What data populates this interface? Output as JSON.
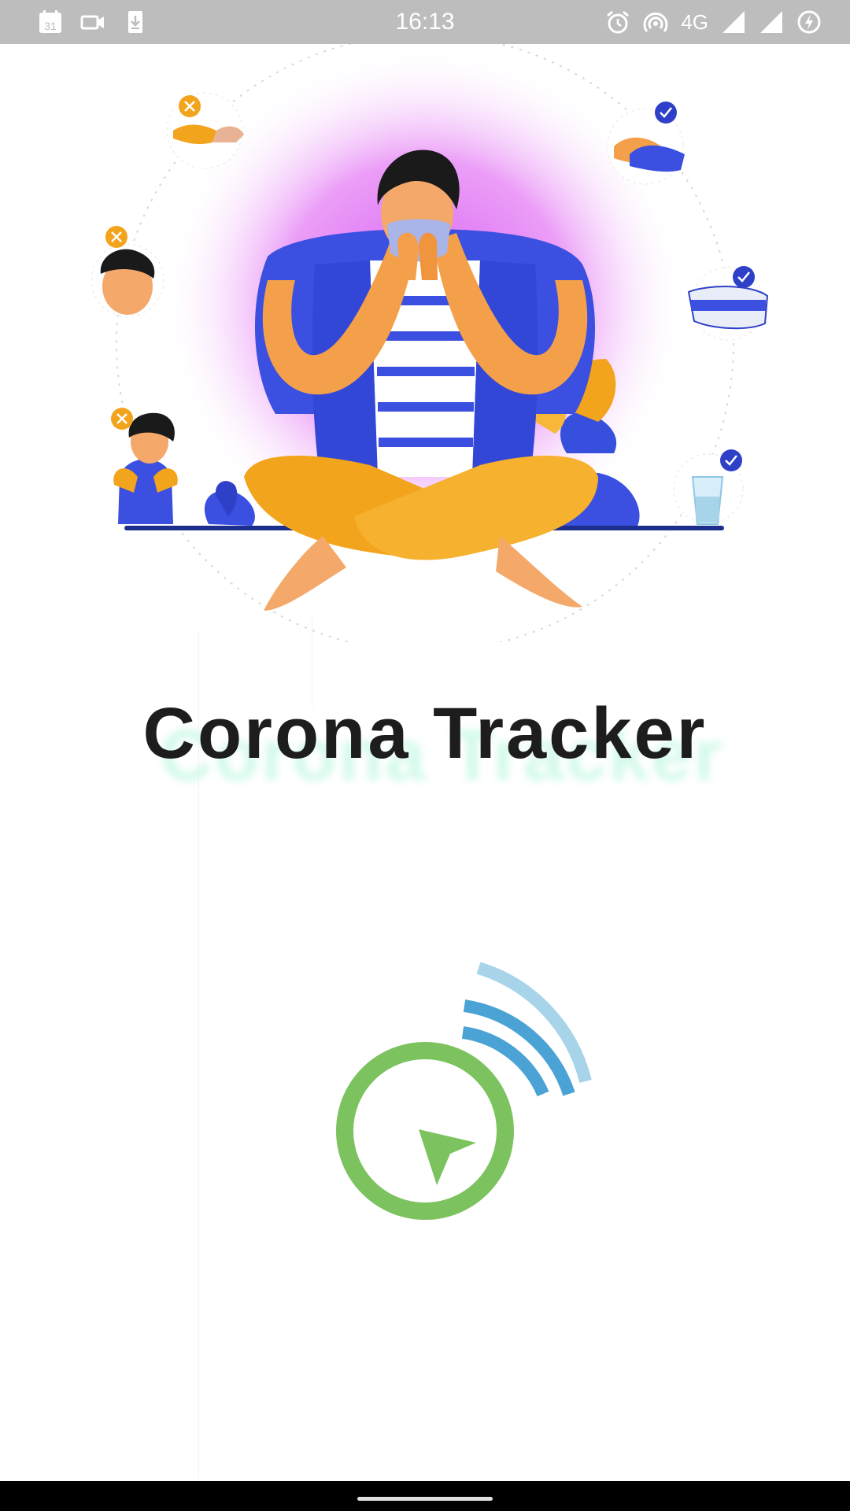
{
  "status_bar": {
    "time": "16:13",
    "network": "4G",
    "left_icons": [
      "calendar-icon",
      "video-camera-icon",
      "download-icon"
    ],
    "left_calendar_day": "31",
    "right_icons": [
      "alarm-icon",
      "hotspot-icon",
      "signal-icon",
      "signal-icon",
      "battery-charging-icon"
    ]
  },
  "app": {
    "title": "Corona Tracker"
  },
  "illustration": {
    "dont_items": [
      "handshake-icon",
      "coughing-man-icon",
      "sneezing-girl-icon"
    ],
    "do_items": [
      "washing-hands-icon",
      "face-mask-icon",
      "water-glass-icon"
    ]
  },
  "colors": {
    "status_bar": "#bdbdbd",
    "title": "#1d1d1d",
    "title_shadow": "#7ef0c2",
    "logo_green": "#7cc35f",
    "logo_wave_dark": "#4aa3d4",
    "logo_wave_light": "#a8d4ea",
    "glow": "#e88cf6",
    "shirt_blue": "#3b4fe0",
    "pants_orange": "#f3a41d",
    "nav_bar": "#000000"
  }
}
